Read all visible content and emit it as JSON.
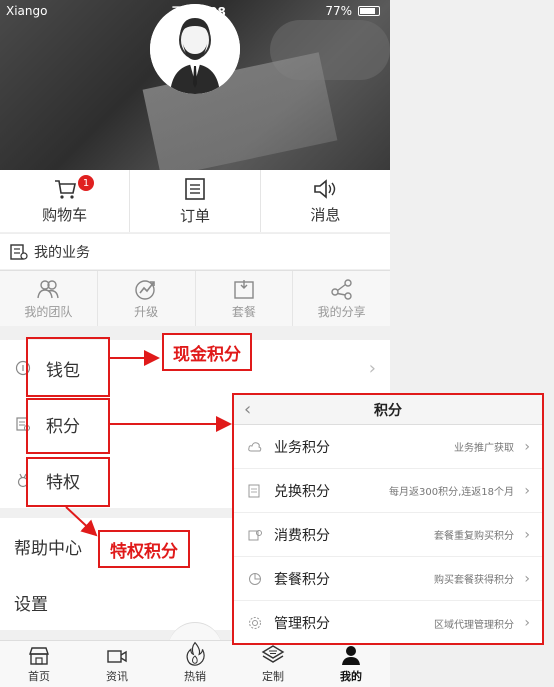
{
  "status_bar": {
    "carrier": "Xiango",
    "time": "下午4:08",
    "battery": "77%"
  },
  "quick_actions": [
    {
      "label": "购物车",
      "badge": "1"
    },
    {
      "label": "订单"
    },
    {
      "label": "消息"
    }
  ],
  "business": {
    "title": "我的业务",
    "items": [
      {
        "label": "我的团队"
      },
      {
        "label": "升级"
      },
      {
        "label": "套餐"
      },
      {
        "label": "我的分享"
      }
    ]
  },
  "menu": [
    {
      "label": "钱包"
    },
    {
      "label": "积分"
    },
    {
      "label": "特权"
    },
    {
      "label": "帮助中心"
    },
    {
      "label": "设置"
    }
  ],
  "annotations": {
    "cash_points": "现金积分",
    "privilege_points": "特权积分"
  },
  "points_panel": {
    "title": "积分",
    "rows": [
      {
        "label": "业务积分",
        "desc": "业务推广获取"
      },
      {
        "label": "兑换积分",
        "desc": "每月返300积分,连返18个月"
      },
      {
        "label": "消费积分",
        "desc": "套餐重复购买积分"
      },
      {
        "label": "套餐积分",
        "desc": "购买套餐获得积分"
      },
      {
        "label": "管理积分",
        "desc": "区域代理管理积分"
      }
    ]
  },
  "tabbar": [
    {
      "label": "首页"
    },
    {
      "label": "资讯"
    },
    {
      "label": "热销"
    },
    {
      "label": "定制"
    },
    {
      "label": "我的"
    }
  ],
  "colors": {
    "accent_red": "#e01a1a",
    "badge_red": "#e02020"
  }
}
